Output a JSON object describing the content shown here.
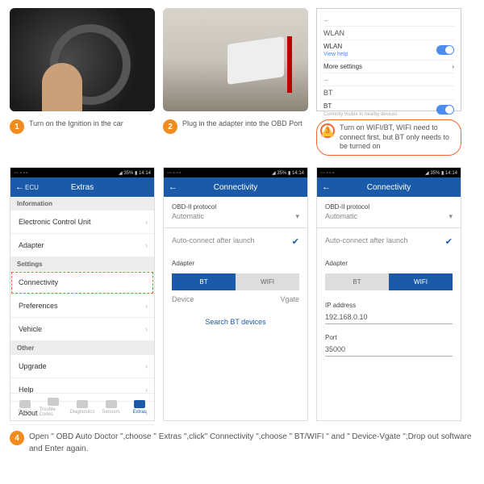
{
  "row1": {
    "step1_caption": "Turn on the Ignition in the car",
    "step2_caption": "Plug in the adapter into the OBD Port",
    "step3_caption": "Turn on WIFI/BT, WIFI need to connect first, but BT only needs to be turned on",
    "settings": {
      "back": "←",
      "wlan_title": "WLAN",
      "wlan_label": "WLAN",
      "view_help": "View help",
      "more_settings": "More settings",
      "bt_title": "BT",
      "bt_label": "BT",
      "bt_sub": "Currently visible to nearby devices",
      "arrow": "›"
    }
  },
  "nums": {
    "n1": "1",
    "n2": "2",
    "n3": "3",
    "n4": "4"
  },
  "status": {
    "left": "⋯ ▫ ▫ ▫",
    "right": "◢ 35% ▮ 14:14"
  },
  "phone1": {
    "appbar_label": "ECU",
    "appbar_back": "←",
    "title": "Extras",
    "hdr_info": "Information",
    "ecu": "Electronic Control Unit",
    "adapter": "Adapter",
    "hdr_settings": "Settings",
    "connectivity": "Connectivity",
    "preferences": "Preferences",
    "vehicle": "Vehicle",
    "hdr_other": "Other",
    "upgrade": "Upgrade",
    "help": "Help",
    "about": "About",
    "tabs": {
      "status": "Status",
      "tc": "Trouble Codes",
      "diag": "Diagnostics",
      "sens": "Sensors",
      "extras": "Extras"
    }
  },
  "phone2": {
    "back": "←",
    "title": "Connectivity",
    "proto_label": "OBD-II protocol",
    "proto_val": "Automatic",
    "auto_label": "Auto-connect after launch",
    "adapter_label": "Adapter",
    "bt": "BT",
    "wifi": "WIFI",
    "device_label": "Device",
    "device_val": "Vgate",
    "search": "Search BT devices"
  },
  "phone3": {
    "back": "←",
    "title": "Connectivity",
    "proto_label": "OBD-II protocol",
    "proto_val": "Automatic",
    "auto_label": "Auto-connect after launch",
    "adapter_label": "Adapter",
    "bt": "BT",
    "wifi": "WIFI",
    "ip_label": "IP address",
    "ip_val": "192.168.0.10",
    "port_label": "Port",
    "port_val": "35000"
  },
  "footer": "Open \" OBD Auto Doctor \",choose \" Extras \",click\" Connectivity \",choose \" BT/WIFI \" and \" Device-Vgate \";Drop out software and Enter again."
}
